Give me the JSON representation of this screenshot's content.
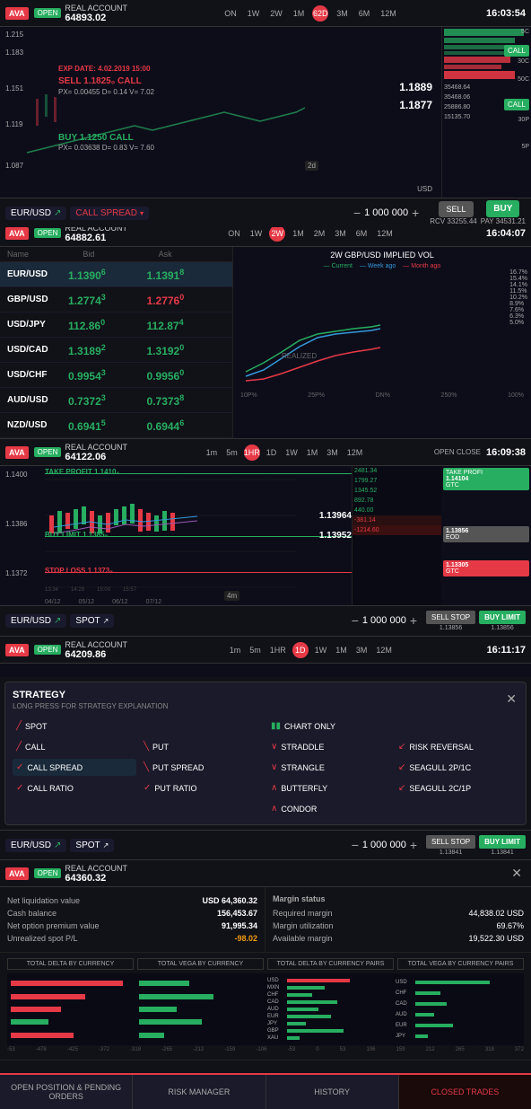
{
  "panel1": {
    "ava_logo": "AVA",
    "open_badge": "OPEN",
    "account_label": "REAL ACCOUNT",
    "account_value": "64893.02",
    "time": "16:03:54",
    "timeframes": [
      "ON",
      "1W",
      "2W",
      "1M",
      "62D",
      "3M",
      "6M",
      "12M"
    ],
    "active_tf": "62D",
    "exp_date": "EXP DATE: 4.02.2019 15:00",
    "sell_call": "SELL 1.1825₀ CALL",
    "sell_px": "PX= 0.00455 D= 0.14 V= 7.02",
    "buy_call": "BUY 1.1250 CALL",
    "buy_px": "PX= 0.03638 D= 0.83 V= 7.60",
    "price_top": "1.215",
    "price_mid1": "1.183",
    "price_mid2": "1.151",
    "price_mid3": "1.119",
    "price_bot": "1.087",
    "price_right1": "1.1889",
    "price_right2": "1.1877",
    "instrument": "EUR/USD",
    "strategy": "CALL SPREAD",
    "quantity": "1 000 000",
    "sell_label": "SELL",
    "buy_label": "BUY",
    "rcv": "RCV 33255.44",
    "pay": "PAY 34531.21"
  },
  "panel2": {
    "open_badge": "OPEN",
    "account_label": "REAL ACCOUNT",
    "account_value": "64882.61",
    "time": "16:04:07",
    "active_tf": "2W",
    "timeframes": [
      "ON",
      "1W",
      "2W",
      "1M",
      "2M",
      "3M",
      "6M",
      "12M"
    ],
    "columns": [
      "Name",
      "Bid",
      "Ask",
      "Current",
      "Week ago",
      "Month ago"
    ],
    "pairs": [
      {
        "name": "EUR/USD",
        "bid": "1.1390",
        "bid_sup": "6",
        "bid_dir": "up",
        "ask": "1.1391",
        "ask_sup": "8",
        "ask_dir": "up",
        "selected": true
      },
      {
        "name": "GBP/USD",
        "bid": "1.2774",
        "bid_sup": "3",
        "bid_dir": "up",
        "ask": "1.2776",
        "ask_sup": "0",
        "ask_dir": "down"
      },
      {
        "name": "USD/JPY",
        "bid": "112.86",
        "bid_sup": "0",
        "bid_dir": "up",
        "ask": "112.87",
        "ask_sup": "4",
        "ask_dir": "up"
      },
      {
        "name": "USD/CAD",
        "bid": "1.3189",
        "bid_sup": "2",
        "bid_dir": "up",
        "ask": "1.3192",
        "ask_sup": "0",
        "ask_dir": "up"
      },
      {
        "name": "USD/CHF",
        "bid": "0.9954",
        "bid_sup": "3",
        "bid_dir": "up",
        "ask": "0.9956",
        "ask_sup": "0",
        "ask_dir": "up"
      },
      {
        "name": "AUD/USD",
        "bid": "0.7372",
        "bid_sup": "3",
        "bid_dir": "up",
        "ask": "0.7373",
        "ask_sup": "8",
        "ask_dir": "up"
      },
      {
        "name": "NZD/USD",
        "bid": "0.6941",
        "bid_sup": "5",
        "bid_dir": "up",
        "ask": "0.6944",
        "ask_sup": "6",
        "ask_dir": "up"
      }
    ],
    "chart_title": "2W GBP/USD IMPLIED VOL",
    "chart_levels": [
      "16.7%",
      "15.4%",
      "14.1%",
      "11.5%",
      "10.2%",
      "8.9%",
      "7.6%",
      "6.3%",
      "5.0%"
    ],
    "chart_labels": [
      "10P%",
      "25P%",
      "DN%",
      "250%",
      "100%"
    ],
    "realized_label": "REALIZED"
  },
  "panel3": {
    "open_badge": "OPEN",
    "account_label": "REAL ACCOUNT",
    "account_value": "64122.06",
    "time": "16:09:38",
    "timeframes": [
      "1m",
      "5m",
      "1HR",
      "1D",
      "1W",
      "1M",
      "3M",
      "12M"
    ],
    "active_tf": "1HR",
    "open_label": "OPEN",
    "close_label": "CLOSE",
    "take_profit": "TAKE PROFIT 1.1410₄",
    "buy_limit": "BUY LIMIT 1.1385₅",
    "stop_loss": "STOP LOSS 1.1373₅",
    "price1": "1.1400",
    "price2": "1.1386",
    "price3": "1.1372",
    "chart_price1": "1.13964",
    "chart_price2": "1.13952",
    "order_levels": [
      "2481.34",
      "1799.27",
      "1345.52",
      "892.78",
      "440.00"
    ],
    "order_neg": "-381.14",
    "order_neg2": "-1214.60",
    "tp_tag": "TAKE PROFI",
    "tp_value": "1.14104",
    "tp_type": "GTC",
    "bl_value": "1.13856",
    "bl_type": "EOD",
    "sl_value": "1.13305",
    "sl_type": "GTC",
    "instrument": "EUR/USD",
    "strategy": "SPOT",
    "quantity": "1 000 000",
    "sell_stop_label": "SELL STOP",
    "buy_limit_label": "BUY LIMIT",
    "sell_price": "1.13856",
    "buy_price": "1.13856"
  },
  "panel4": {
    "open_badge": "OPEN",
    "account_label": "REAL ACCOUNT",
    "account_value": "64209.86",
    "time": "16:11:17",
    "active_tf": "1D",
    "strategy_title": "STRATEGY",
    "strategy_subtitle": "LONG PRESS FOR STRATEGY EXPLANATION",
    "strategies": [
      {
        "icon": "slash",
        "label": "SPOT",
        "col": 1
      },
      {
        "icon": "chart",
        "label": "CHART ONLY",
        "col": 2
      },
      {
        "icon": "slash",
        "label": "CALL",
        "col": 1
      },
      {
        "icon": "slash",
        "label": "PUT",
        "col": 2
      },
      {
        "icon": "v-slash",
        "label": "STRADDLE",
        "col": 3
      },
      {
        "icon": "arrow",
        "label": "RISK REVERSAL",
        "col": 4
      },
      {
        "icon": "v-slash-check",
        "label": "CALL SPREAD",
        "col": 1
      },
      {
        "icon": "v-slash",
        "label": "PUT SPREAD",
        "col": 2
      },
      {
        "icon": "v-slash",
        "label": "STRANGLE",
        "col": 3
      },
      {
        "icon": "seagull",
        "label": "SEAGULL 2P/1C",
        "col": 4
      },
      {
        "icon": "v-ratio",
        "label": "CALL RATIO",
        "col": 1
      },
      {
        "icon": "v-ratio",
        "label": "PUT RATIO",
        "col": 2
      },
      {
        "icon": "butterfly",
        "label": "BUTTERFLY",
        "col": 3
      },
      {
        "icon": "seagull2",
        "label": "SEAGULL 2C/1P",
        "col": 4
      },
      {
        "icon": "condor",
        "label": "CONDOR",
        "col": 3
      }
    ],
    "instrument": "EUR/USD",
    "strategy": "SPOT",
    "quantity": "1 000 000",
    "sell_stop_label": "SELL STOP",
    "buy_limit_label": "BUY LIMIT",
    "sell_price": "1.13841",
    "buy_price": "1.13841"
  },
  "panel5": {
    "open_badge": "OPEN",
    "account_label": "REAL ACCOUNT",
    "account_value": "64360.32",
    "net_liq_label": "Net liquidation value",
    "net_liq_value": "USD 64,360.32",
    "cash_label": "Cash balance",
    "cash_value": "156,453.67",
    "net_option_label": "Net option premium value",
    "net_option_value": "91,995.34",
    "unrealized_label": "Unrealized spot P/L",
    "unrealized_value": "-98.02",
    "margin_status_label": "Margin status",
    "required_margin_label": "Required margin",
    "required_margin_value": "44,838.02 USD",
    "margin_util_label": "Margin utilization",
    "margin_util_value": "69.67%",
    "available_margin_label": "Available margin",
    "available_margin_value": "19,522.30 USD",
    "delta_title1": "TOTAL DELTA BY CURRENCY",
    "delta_title2": "TOTAL VEGA BY CURRENCY",
    "delta_title3": "TOTAL DELTA BY CURRENCY PAIRS",
    "delta_title4": "TOTAL VEGA BY CURRENCY PAIRS",
    "currency_labels": [
      "USD",
      "MXN",
      "CHF",
      "CAD",
      "AUD",
      "EUR",
      "JPY",
      "GBP",
      "XAU"
    ],
    "axis_left": [
      "-53",
      "-478",
      "-425",
      "-372",
      "-318",
      "-265",
      "-212",
      "-159",
      "-106",
      "-53",
      "0",
      "53",
      "106",
      "159",
      "212",
      "265",
      "318",
      "372"
    ]
  },
  "bottom_nav": {
    "items": [
      {
        "label": "OPEN POSITION & PENDING ORDERS",
        "active": false
      },
      {
        "label": "RISK MANAGER",
        "active": false
      },
      {
        "label": "HISTORY",
        "active": false
      },
      {
        "label": "CLOSED TRADES",
        "active": false
      }
    ]
  }
}
